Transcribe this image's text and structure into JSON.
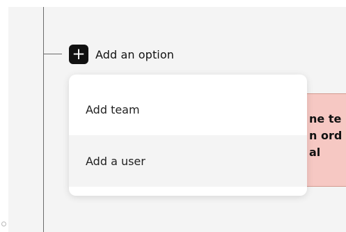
{
  "app": {
    "title": ""
  },
  "tree": {
    "add_option_label": "Add an option",
    "add_option_icon": "plus-square-icon"
  },
  "dropdown": {
    "items": [
      {
        "label": "Add team"
      },
      {
        "label": "Add a user"
      }
    ]
  },
  "alert": {
    "text": "ne te\nn ord\nal"
  },
  "colors": {
    "background": "#f4f4f4",
    "panel": "#ffffff",
    "plus_icon": "#111111",
    "alert_bg": "#f6c8c3",
    "alert_border": "#d3998e"
  }
}
